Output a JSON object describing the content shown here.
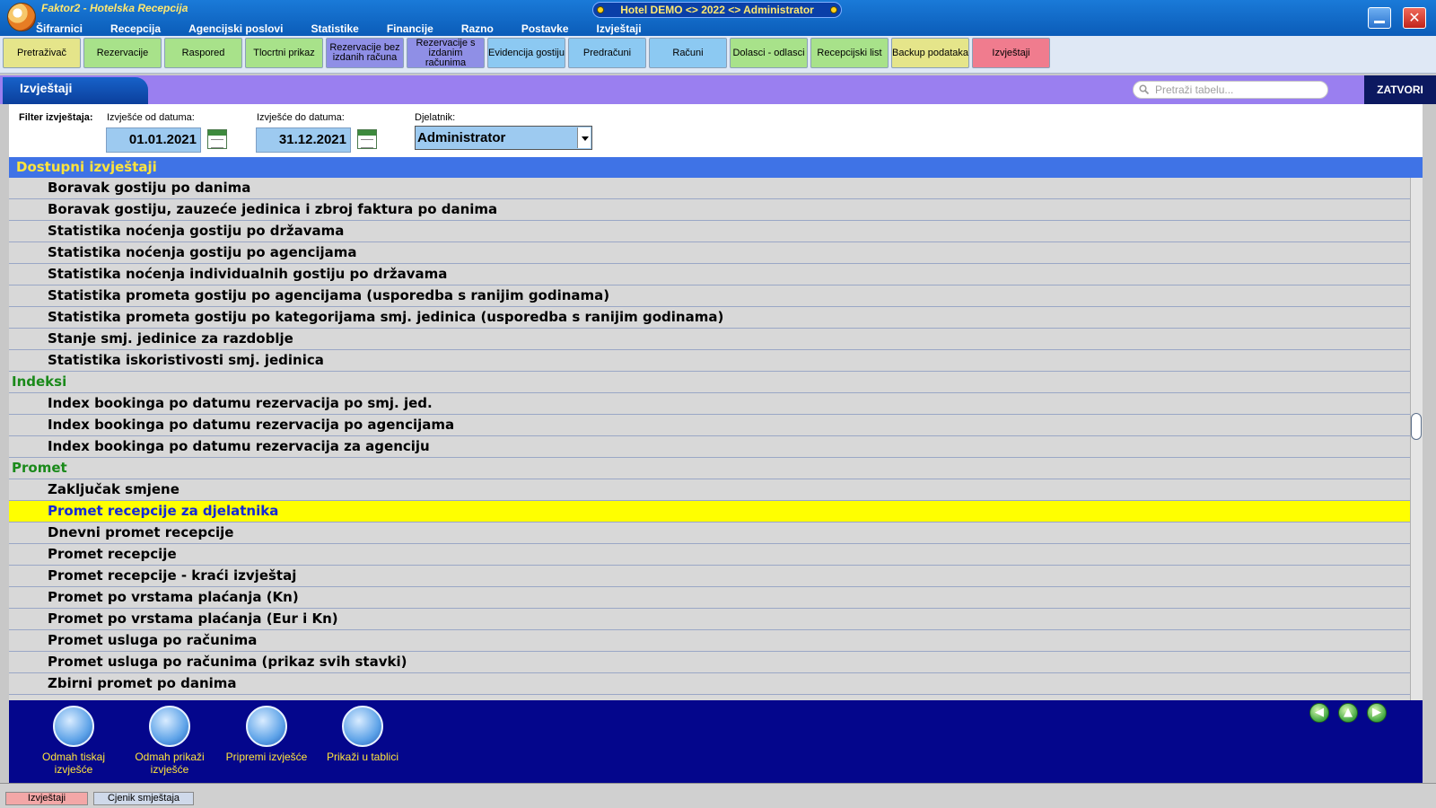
{
  "window": {
    "app_title": "Faktor2 - Hotelska Recepcija",
    "caption": "Hotel DEMO <> 2022 <> Administrator",
    "close_glyph": "✕"
  },
  "menu": [
    "Šifrarnici",
    "Recepcija",
    "Agencijski poslovi",
    "Statistike",
    "Financije",
    "Razno",
    "Postavke",
    "Izvještaji"
  ],
  "toolbar": [
    {
      "label": "Pretraživač",
      "color": "#e5e58a"
    },
    {
      "label": "Rezervacije",
      "color": "#a8e28a"
    },
    {
      "label": "Raspored",
      "color": "#a8e28a"
    },
    {
      "label": "Tlocrtni prikaz",
      "color": "#a8e28a"
    },
    {
      "label": "Rezervacije bez izdanih računa",
      "color": "#8f8fe6"
    },
    {
      "label": "Rezervacije s izdanim računima",
      "color": "#8f8fe6"
    },
    {
      "label": "Evidencija gostiju",
      "color": "#8cc9f2"
    },
    {
      "label": "Predračuni",
      "color": "#8cc9f2"
    },
    {
      "label": "Računi",
      "color": "#8cc9f2"
    },
    {
      "label": "Dolasci - odlasci",
      "color": "#a8e28a"
    },
    {
      "label": "Recepcijski list",
      "color": "#a8e28a"
    },
    {
      "label": "Backup podataka",
      "color": "#e5e58a"
    },
    {
      "label": "Izvještaji",
      "color": "#f07c8e"
    }
  ],
  "panel": {
    "title": "Izvještaji",
    "search_placeholder": "Pretraži tabelu...",
    "close_label": "ZATVORI"
  },
  "filter": {
    "section_label": "Filter izvještaja:",
    "from_label": "Izvješće od datuma:",
    "from_value": "01.01.2021",
    "to_label": "Izvješće do datuma:",
    "to_value": "31.12.2021",
    "employee_label": "Djelatnik:",
    "employee_value": "Administrator"
  },
  "list": {
    "header": "Dostupni izvještaji",
    "rows": [
      {
        "type": "report",
        "text": "Boravak gostiju po danima"
      },
      {
        "type": "report",
        "text": "Boravak gostiju, zauzeće jedinica i zbroj faktura po danima"
      },
      {
        "type": "report",
        "text": "Statistika noćenja gostiju po državama"
      },
      {
        "type": "report",
        "text": "Statistika noćenja gostiju po agencijama"
      },
      {
        "type": "report",
        "text": "Statistika noćenja individualnih gostiju po državama"
      },
      {
        "type": "report",
        "text": "Statistika prometa gostiju po agencijama (usporedba s ranijim godinama)"
      },
      {
        "type": "report",
        "text": "Statistika prometa gostiju po kategorijama smj. jedinica (usporedba s ranijim godinama)"
      },
      {
        "type": "report",
        "text": "Stanje smj. jedinice za razdoblje"
      },
      {
        "type": "report",
        "text": "Statistika iskoristivosti smj. jedinica"
      },
      {
        "type": "category",
        "text": "Indeksi"
      },
      {
        "type": "report",
        "text": "Index bookinga po datumu rezervacija po smj. jed."
      },
      {
        "type": "report",
        "text": "Index bookinga po datumu rezervacija po agencijama"
      },
      {
        "type": "report",
        "text": "Index bookinga po datumu rezervacija za agenciju"
      },
      {
        "type": "category",
        "text": "Promet"
      },
      {
        "type": "report",
        "text": "Zaključak smjene"
      },
      {
        "type": "report",
        "text": "Promet recepcije za djelatnika",
        "selected": true
      },
      {
        "type": "report",
        "text": "Dnevni promet recepcije"
      },
      {
        "type": "report",
        "text": "Promet recepcije"
      },
      {
        "type": "report",
        "text": "Promet recepcije - kraći izvještaj"
      },
      {
        "type": "report",
        "text": "Promet po vrstama plaćanja (Kn)"
      },
      {
        "type": "report",
        "text": "Promet po vrstama plaćanja (Eur i Kn)"
      },
      {
        "type": "report",
        "text": "Promet usluga po računima"
      },
      {
        "type": "report",
        "text": "Promet usluga po računima (prikaz svih stavki)"
      },
      {
        "type": "report",
        "text": "Zbirni promet po danima"
      }
    ]
  },
  "actions": [
    {
      "label": "Odmah tiskaj izvješće",
      "icon": "printer-icon"
    },
    {
      "label": "Odmah prikaži izvješće",
      "icon": "document-preview-icon"
    },
    {
      "label": "Pripremi izvješće",
      "icon": "prepare-print-icon"
    },
    {
      "label": "Prikaži u tablici",
      "icon": "table-view-icon"
    }
  ],
  "nav": {
    "prev": "◀",
    "up": "▲",
    "next": "▶"
  },
  "bottom_tabs": [
    {
      "label": "Izvještaji",
      "color": "#f3a7a7"
    },
    {
      "label": "Cjenik smještaja",
      "color": "#cfd9ea"
    }
  ]
}
